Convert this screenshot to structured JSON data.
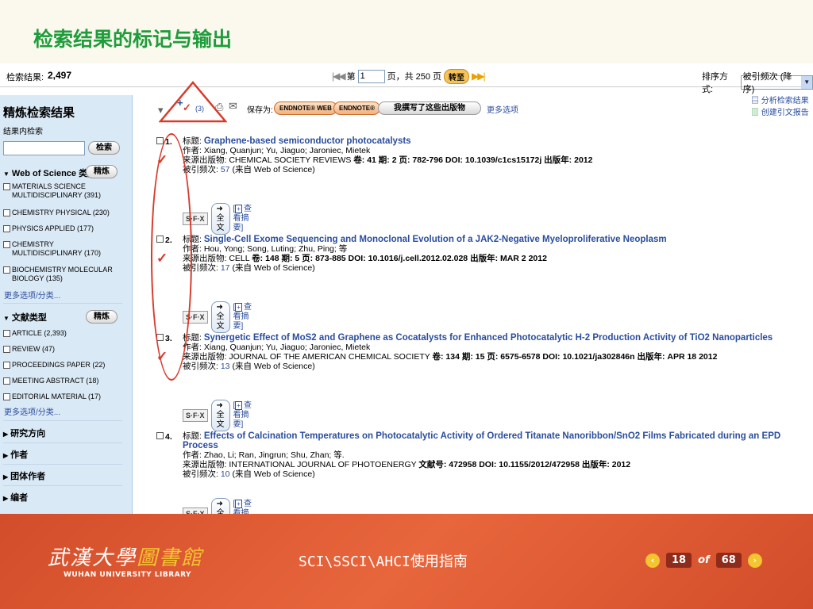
{
  "slide": {
    "title": "检索结果的标记与输出",
    "footer_title": "SCI\\SSCI\\AHCI使用指南",
    "logo_cn_1": "武漢大學",
    "logo_cn_2": "圖書館",
    "logo_en": "WUHAN UNIVERSITY LIBRARY",
    "page_current": "18",
    "page_of": "of",
    "page_total": "68"
  },
  "topbar": {
    "count_label": "检索结果:",
    "count_value": "2,497",
    "page_prefix": "第",
    "page_value": "1",
    "page_suffix": "页，共 250 页",
    "go_label": "转至",
    "sort_label": "排序方式:",
    "sort_value": "被引频次 (降序)"
  },
  "sidebar": {
    "title": "精炼检索结果",
    "search_within": "结果内检索",
    "search_button": "检索",
    "category_title": "Web of Science 类别",
    "refine_button": "精炼",
    "categories": [
      "MATERIALS SCIENCE MULTIDISCIPLINARY (391)",
      "CHEMISTRY PHYSICAL (230)",
      "PHYSICS APPLIED (177)",
      "CHEMISTRY MULTIDISCIPLINARY (170)",
      "BIOCHEMISTRY MOLECULAR BIOLOGY (135)"
    ],
    "more_1": "更多选项/分类...",
    "doctype_title": "文献类型",
    "doctypes": [
      "ARTICLE (2,393)",
      "REVIEW (47)",
      "PROCEEDINGS PAPER (22)",
      "MEETING ABSTRACT (18)",
      "EDITORIAL MATERIAL (17)"
    ],
    "more_2": "更多选项/分类...",
    "collapsed": [
      "研究方向",
      "作者",
      "团体作者",
      "编者"
    ]
  },
  "toolbar": {
    "marked_count": "(3)",
    "save_label": "保存为:",
    "endnote_web": "ENDNOTE® WEB",
    "endnote": "ENDNOTE®",
    "pub_label": "我撰写了这些出版物",
    "more_options": "更多选项",
    "analyze": "分析检索结果",
    "citation_report": "创建引文报告"
  },
  "labels": {
    "title": "标题:",
    "authors": "作者:",
    "source": "来源出版物:",
    "cited": "被引频次:",
    "cited_src": "(来自 Web of Science)",
    "fulltext": "全文",
    "abstract": "查看摘要",
    "sfx": "S·F·X"
  },
  "results": [
    {
      "num": "1.",
      "title": "Graphene-based semiconductor photocatalysts",
      "authors": "Xiang, Quanjun; Yu, Jiaguo; Jaroniec, Mietek",
      "source": "CHEMICAL SOCIETY REVIEWS",
      "meta": "卷: 41  期: 2  页: 782-796  DOI: 10.1039/c1cs15172j  出版年: 2012",
      "cited": "57"
    },
    {
      "num": "2.",
      "title": "Single-Cell Exome Sequencing and Monoclonal Evolution of a JAK2-Negative Myeloproliferative Neoplasm",
      "authors": "Hou, Yong; Song, Luting; Zhu, Ping; 等",
      "source": "CELL",
      "meta": "卷: 148  期: 5  页: 873-885  DOI: 10.1016/j.cell.2012.02.028  出版年: MAR 2 2012",
      "cited": "17"
    },
    {
      "num": "3.",
      "title": "Synergetic Effect of MoS2 and Graphene as Cocatalysts for Enhanced Photocatalytic H-2 Production Activity of TiO2 Nanoparticles",
      "authors": "Xiang, Quanjun; Yu, Jiaguo; Jaroniec, Mietek",
      "source": "JOURNAL OF THE AMERICAN CHEMICAL SOCIETY",
      "meta": "卷: 134  期: 15  页: 6575-6578  DOI: 10.1021/ja302846n  出版年: APR 18 2012",
      "cited": "13"
    },
    {
      "num": "4.",
      "title": "Effects of Calcination Temperatures on Photocatalytic Activity of Ordered Titanate Nanoribbon/SnO2 Films Fabricated during an EPD Process",
      "authors": "Zhao, Li; Ran, Jingrun; Shu, Zhan; 等.",
      "source": "INTERNATIONAL JOURNAL OF PHOTOENERGY",
      "meta": "文献号: 472958  DOI: 10.1155/2012/472958  出版年: 2012",
      "cited": "10"
    }
  ],
  "colors": {
    "accent_red": "#d83a2a",
    "link_blue": "#2a4d9c",
    "title_green": "#1f9c3b"
  }
}
